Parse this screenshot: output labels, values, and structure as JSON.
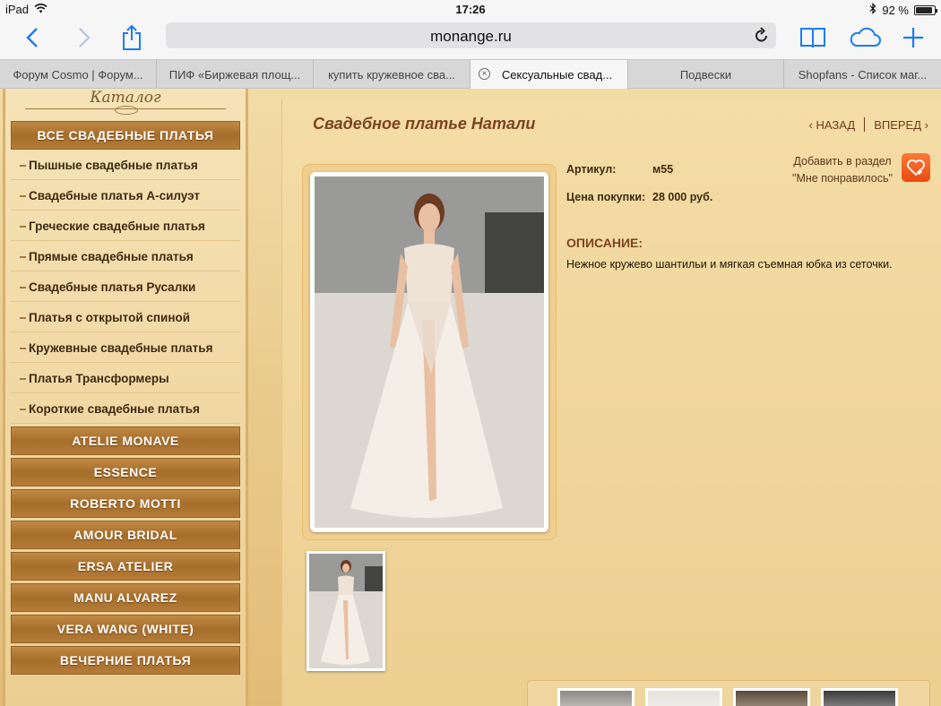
{
  "status_bar": {
    "device": "iPad",
    "time": "17:26",
    "battery_text": "92 %",
    "battery_level": 0.92
  },
  "toolbar": {
    "url": "monange.ru"
  },
  "tabs": [
    {
      "label": "Форум Cosmo | Форум...",
      "active": false
    },
    {
      "label": "ПИФ «Биржевая площ...",
      "active": false
    },
    {
      "label": "купить кружевное сва...",
      "active": false
    },
    {
      "label": "Сексуальные свад...",
      "active": true
    },
    {
      "label": "Подвески",
      "active": false
    },
    {
      "label": "Shopfans - Список маг...",
      "active": false
    }
  ],
  "sidebar": {
    "title": "Каталог",
    "all_dresses": "ВСЕ СВАДЕБНЫЕ ПЛАТЬЯ",
    "sub_items": [
      "Пышные свадебные платья",
      "Свадебные платья А-силуэт",
      "Греческие свадебные платья",
      "Прямые свадебные платья",
      "Свадебные платья Русалки",
      "Платья с открытой спиной",
      "Кружевные свадебные платья",
      "Платья Трансформеры",
      "Короткие свадебные платья"
    ],
    "brands": [
      "ATELIE MONAVE",
      "ESSENCE",
      "ROBERTO MOTTI",
      "AMOUR BRIDAL",
      "ERSA ATELIER",
      "MANU ALVAREZ",
      "VERA WANG (WHITE)",
      "ВЕЧЕРНИЕ ПЛАТЬЯ"
    ]
  },
  "product": {
    "title": "Свадебное платье Натали",
    "nav_back": "НАЗАД",
    "nav_forward": "ВПЕРЕД",
    "article_label": "Артикул:",
    "article_value": "м55",
    "price_label": "Цена покупки:",
    "price_value": "28 000 руб.",
    "description_heading": "ОПИСАНИЕ:",
    "description_text": "Нежное кружево шантильи и мягкая съемная юбка из сеточки.",
    "favorite_line1": "Добавить в раздел",
    "favorite_line2": "\"Мне понравилось\""
  },
  "colors": {
    "accent_blue": "#1a7cf6",
    "title_brown": "#7b4322",
    "menu_gold": "#a66d2b",
    "fav_orange": "#e94a12"
  }
}
